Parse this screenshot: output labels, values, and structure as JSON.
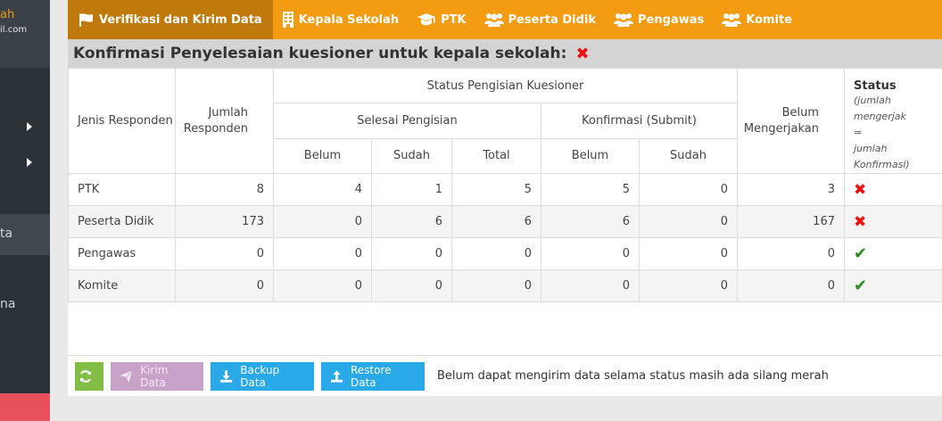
{
  "sidebar": {
    "user_name_fragment": "ah",
    "user_email_fragment": "il.com",
    "item_active_fragment": "ta",
    "item_other_fragment": "na"
  },
  "tabs": [
    {
      "label": "Verifikasi dan Kirim Data",
      "icon": "flag-icon"
    },
    {
      "label": "Kepala Sekolah",
      "icon": "building-icon"
    },
    {
      "label": "PTK",
      "icon": "graduation-cap-icon"
    },
    {
      "label": "Peserta Didik",
      "icon": "users-icon"
    },
    {
      "label": "Pengawas",
      "icon": "users-icon"
    },
    {
      "label": "Komite",
      "icon": "users-icon"
    }
  ],
  "heading": {
    "title": "Konfirmasi Penyelesaian kuesioner untuk kepala sekolah:",
    "status_mark": "✖"
  },
  "table": {
    "col_jenis": "Jenis Responden",
    "col_jumlah": "Jumlah Responden",
    "col_status_pengisian": "Status Pengisian Kuesioner",
    "col_selesai": "Selesai Pengisian",
    "col_konfirmasi": "Konfirmasi (Submit)",
    "col_belum_mengerjakan": "Belum Mengerjakan",
    "col_status": "Status",
    "col_status_note1": "(jumlah mengerjak",
    "col_status_note2": "=",
    "col_status_note3": "jumlah Konfirmasi)",
    "sub_belum": "Belum",
    "sub_sudah": "Sudah",
    "sub_total": "Total",
    "sub_k_belum": "Belum",
    "sub_k_sudah": "Sudah",
    "rows": [
      {
        "jenis": "PTK",
        "jumlah": "8",
        "s_belum": "4",
        "s_sudah": "1",
        "s_total": "5",
        "k_belum": "5",
        "k_sudah": "0",
        "belum_mengerjakan": "3",
        "status": "cross"
      },
      {
        "jenis": "Peserta Didik",
        "jumlah": "173",
        "s_belum": "0",
        "s_sudah": "6",
        "s_total": "6",
        "k_belum": "6",
        "k_sudah": "0",
        "belum_mengerjakan": "167",
        "status": "cross"
      },
      {
        "jenis": "Pengawas",
        "jumlah": "0",
        "s_belum": "0",
        "s_sudah": "0",
        "s_total": "0",
        "k_belum": "0",
        "k_sudah": "0",
        "belum_mengerjakan": "0",
        "status": "check"
      },
      {
        "jenis": "Komite",
        "jumlah": "0",
        "s_belum": "0",
        "s_sudah": "0",
        "s_total": "0",
        "k_belum": "0",
        "k_sudah": "0",
        "belum_mengerjakan": "0",
        "status": "check"
      }
    ]
  },
  "actions": {
    "kirim_label": "Kirim Data",
    "backup_label": "Backup Data",
    "restore_label": "Restore Data",
    "message": "Belum dapat mengirim data selama status masih ada silang merah"
  },
  "colors": {
    "tab_bar": "#f39c12",
    "tab_active": "#c07a0b",
    "cross": "#e11111",
    "check": "#2a8a1f",
    "button_blue": "#29a9e7",
    "button_green": "#82bd45",
    "button_disabled": "#c9a2c9"
  }
}
